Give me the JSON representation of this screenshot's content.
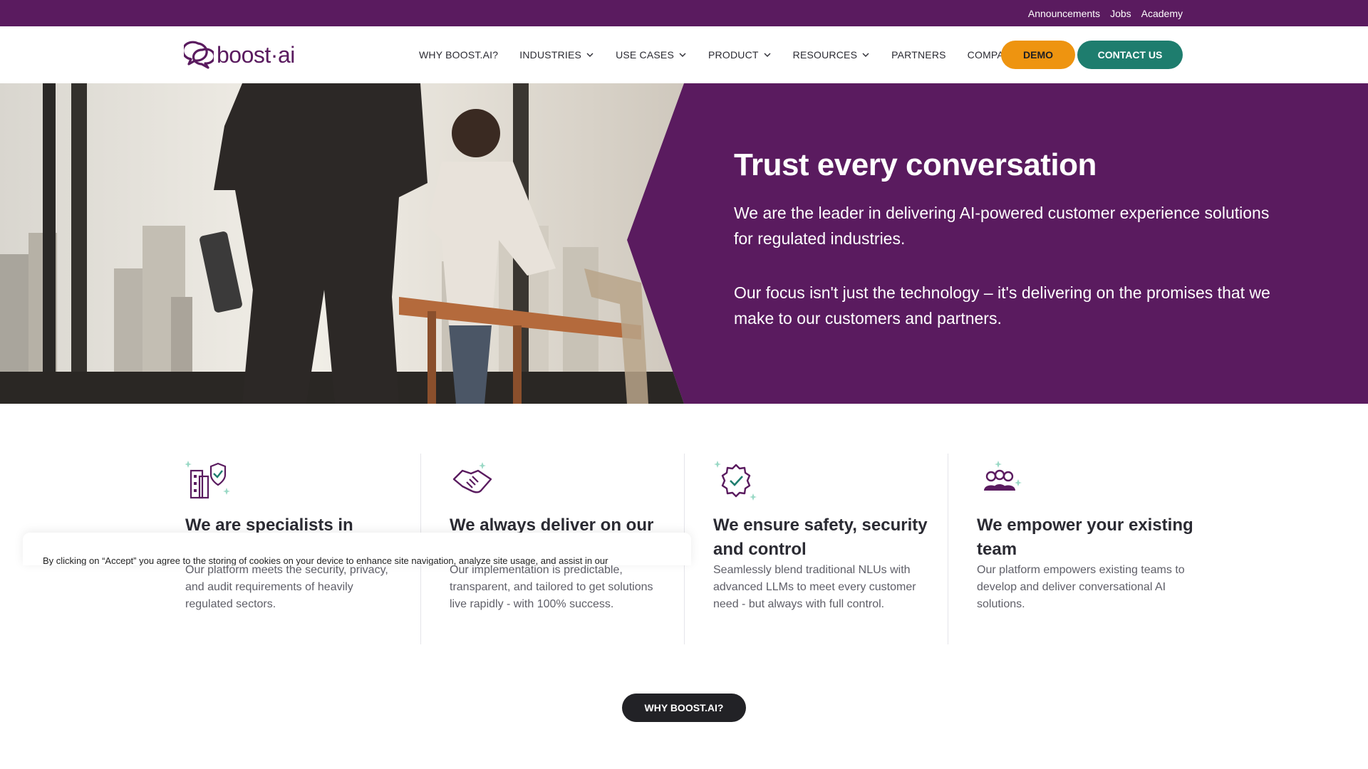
{
  "topbar": {
    "links": [
      "Announcements",
      "Jobs",
      "Academy"
    ]
  },
  "logo": {
    "text": "boost·ai"
  },
  "nav": {
    "items": [
      {
        "label": "WHY BOOST.AI?",
        "dropdown": false
      },
      {
        "label": "INDUSTRIES",
        "dropdown": true
      },
      {
        "label": "USE CASES",
        "dropdown": true
      },
      {
        "label": "PRODUCT",
        "dropdown": true
      },
      {
        "label": "RESOURCES",
        "dropdown": true
      },
      {
        "label": "PARTNERS",
        "dropdown": false
      },
      {
        "label": "COMPANY",
        "dropdown": true
      }
    ],
    "demo_label": "DEMO",
    "contact_label": "CONTACT US"
  },
  "hero": {
    "title": "Trust every conversation",
    "paragraph1": "We are the leader in delivering AI-powered customer experience solutions for regulated industries.",
    "paragraph2": "Our focus isn't just the technology – it's delivering on the promises that we make to our customers and partners."
  },
  "features": [
    {
      "icon": "building-shield-icon",
      "title": "We are specialists in",
      "desc": "Our platform meets the security, privacy, and audit requirements of heavily regulated sectors."
    },
    {
      "icon": "handshake-icon",
      "title": "We always deliver on our",
      "desc": "Our implementation is predictable, transparent, and tailored to get solutions live rapidly - with 100% success."
    },
    {
      "icon": "verified-badge-icon",
      "title": "We ensure safety, security and control",
      "desc": "Seamlessly blend traditional NLUs with advanced LLMs to meet every customer need - but always with full control."
    },
    {
      "icon": "team-icon",
      "title": "We empower your existing team",
      "desc": "Our platform empowers existing teams to develop and deliver conversational AI solutions."
    }
  ],
  "why_button": "WHY BOOST.AI?",
  "cookie": {
    "text": "By clicking on “Accept” you agree to the storing of cookies on your device to enhance site navigation, analyze site usage, and assist in our"
  },
  "colors": {
    "brand_purple": "#5a1b5f",
    "demo_orange": "#ee9410",
    "contact_green": "#1e7d6e",
    "sparkle_mint": "#9ad9c6"
  }
}
